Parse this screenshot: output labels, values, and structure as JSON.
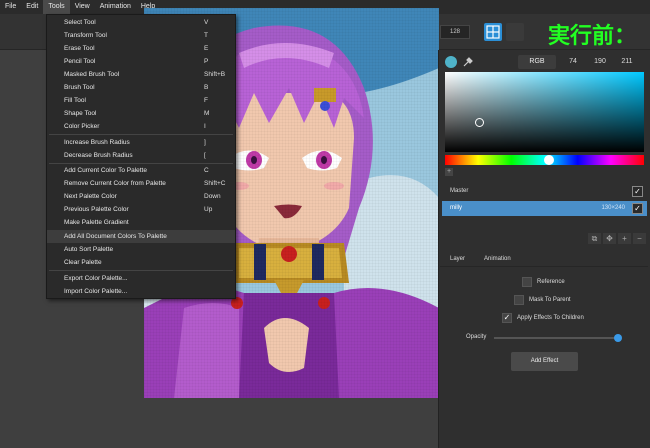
{
  "menubar": [
    "File",
    "Edit",
    "Tools",
    "View",
    "Animation",
    "Help"
  ],
  "overlay_text": "実行前：",
  "toolbar": {
    "size_value": "128",
    "size_value2": "128"
  },
  "color": {
    "mode": "RGB",
    "r": "74",
    "g": "190",
    "b": "211",
    "current_hex": "#4fb3c9"
  },
  "layers": {
    "master": "Master",
    "milly": "milly",
    "milly_dims": "130×240"
  },
  "panel_tabs": [
    "Layer",
    "Animation"
  ],
  "props": {
    "reference": "Reference",
    "mask": "Mask To Parent",
    "apply_effects": "Apply Effects To Children",
    "opacity": "Opacity",
    "add_effect": "Add Effect"
  },
  "tools_menu": {
    "group1": [
      {
        "label": "Select Tool",
        "shortcut": "V"
      },
      {
        "label": "Transform Tool",
        "shortcut": "T"
      },
      {
        "label": "Erase Tool",
        "shortcut": "E"
      },
      {
        "label": "Pencil Tool",
        "shortcut": "P"
      },
      {
        "label": "Masked Brush Tool",
        "shortcut": "Shift+B"
      },
      {
        "label": "Brush Tool",
        "shortcut": "B"
      },
      {
        "label": "Fill Tool",
        "shortcut": "F"
      },
      {
        "label": "Shape Tool",
        "shortcut": "M"
      },
      {
        "label": "Color Picker",
        "shortcut": "I"
      }
    ],
    "group2": [
      {
        "label": "Increase Brush Radius",
        "shortcut": "]"
      },
      {
        "label": "Decrease Brush Radius",
        "shortcut": "["
      }
    ],
    "group3": [
      {
        "label": "Add Current Color To Palette",
        "shortcut": "C"
      },
      {
        "label": "Remove Current Color from Palette",
        "shortcut": "Shift+C"
      },
      {
        "label": "Next Palette Color",
        "shortcut": "Down"
      },
      {
        "label": "Previous Palette Color",
        "shortcut": "Up"
      },
      {
        "label": "Make Palette Gradient",
        "shortcut": ""
      },
      {
        "label": "Add All Document Colors To Palette",
        "shortcut": ""
      },
      {
        "label": "Auto Sort Palette",
        "shortcut": ""
      },
      {
        "label": "Clear Palette",
        "shortcut": ""
      }
    ],
    "group4": [
      {
        "label": "Export Color Palette...",
        "shortcut": ""
      },
      {
        "label": "Import Color Palette...",
        "shortcut": ""
      }
    ]
  }
}
